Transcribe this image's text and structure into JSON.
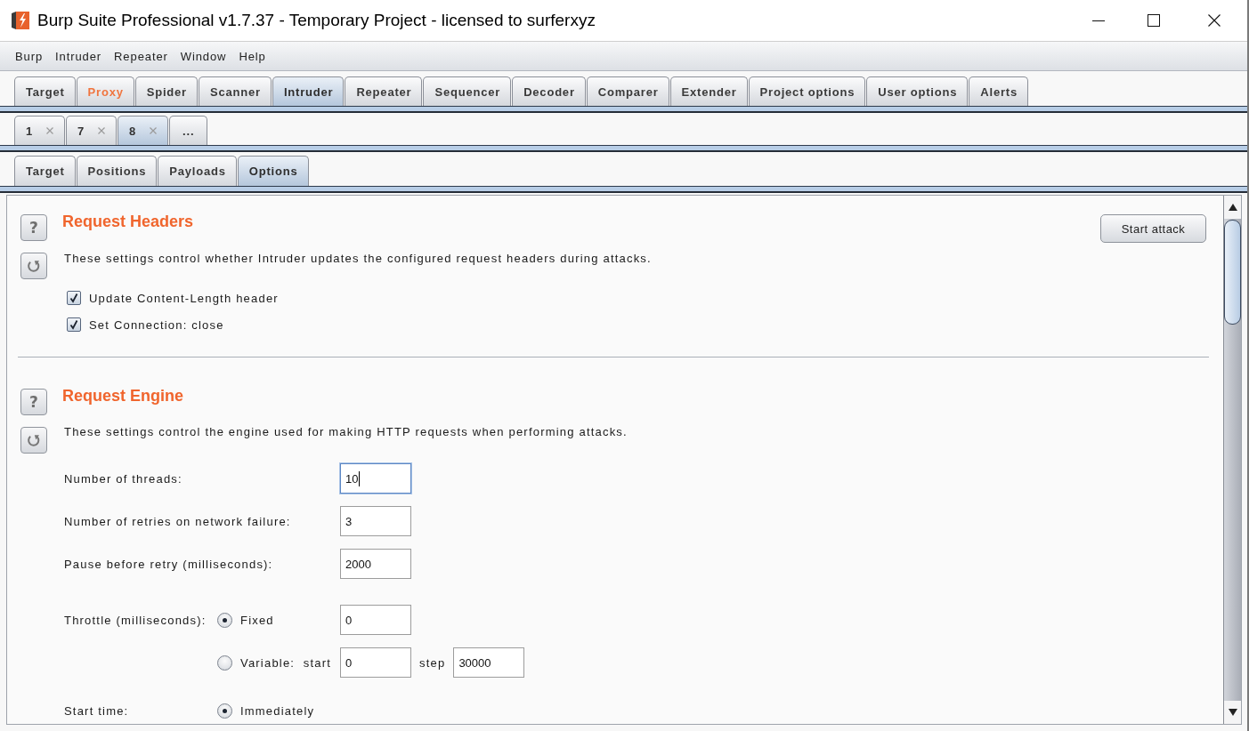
{
  "window": {
    "title": "Burp Suite Professional v1.7.37 - Temporary Project - licensed to surferxyz"
  },
  "menu": [
    {
      "label": "Burp"
    },
    {
      "label": "Intruder"
    },
    {
      "label": "Repeater"
    },
    {
      "label": "Window"
    },
    {
      "label": "Help"
    }
  ],
  "main_tabs": [
    {
      "label": "Target",
      "selected": false,
      "highlighted": false
    },
    {
      "label": "Proxy",
      "selected": false,
      "highlighted": true
    },
    {
      "label": "Spider",
      "selected": false,
      "highlighted": false
    },
    {
      "label": "Scanner",
      "selected": false,
      "highlighted": false
    },
    {
      "label": "Intruder",
      "selected": true,
      "highlighted": false
    },
    {
      "label": "Repeater",
      "selected": false,
      "highlighted": false
    },
    {
      "label": "Sequencer",
      "selected": false,
      "highlighted": false
    },
    {
      "label": "Decoder",
      "selected": false,
      "highlighted": false
    },
    {
      "label": "Comparer",
      "selected": false,
      "highlighted": false
    },
    {
      "label": "Extender",
      "selected": false,
      "highlighted": false
    },
    {
      "label": "Project options",
      "selected": false,
      "highlighted": false
    },
    {
      "label": "User options",
      "selected": false,
      "highlighted": false
    },
    {
      "label": "Alerts",
      "selected": false,
      "highlighted": false
    }
  ],
  "attack_tabs": [
    {
      "label": "1",
      "selected": false,
      "closable": true
    },
    {
      "label": "7",
      "selected": false,
      "closable": true
    },
    {
      "label": "8",
      "selected": true,
      "closable": true
    },
    {
      "label": "...",
      "selected": false,
      "closable": false
    }
  ],
  "sub_tabs": [
    {
      "label": "Target",
      "selected": false
    },
    {
      "label": "Positions",
      "selected": false
    },
    {
      "label": "Payloads",
      "selected": false
    },
    {
      "label": "Options",
      "selected": true
    }
  ],
  "sections": [
    {
      "title": "Request Headers",
      "help": "?",
      "button": "Start attack",
      "description": "These settings control whether Intruder updates the configured request headers during attacks.",
      "settings": [
        {
          "kind": "checkbox",
          "label": "Update Content-Length header",
          "checked": true
        },
        {
          "kind": "checkbox",
          "label": "Set Connection: close",
          "checked": true
        }
      ]
    },
    {
      "title": "Request Engine",
      "help": "?",
      "description": "These settings control the engine used for making HTTP requests when performing attacks.",
      "settings": [
        {
          "kind": "field",
          "label": "Number of threads:",
          "value": "10",
          "focused": true
        },
        {
          "kind": "field",
          "label": "Number of retries on network failure:",
          "value": "3",
          "focused": false
        },
        {
          "kind": "field",
          "label": "Pause before retry (milliseconds):",
          "value": "2000",
          "focused": false
        },
        {
          "kind": "choice",
          "label": "Throttle (milliseconds):",
          "options": [
            {
              "label": "Fixed",
              "selected": true,
              "value": "0"
            },
            {
              "label": "Variable:",
              "selected": false,
              "start_label": "start",
              "value": "0",
              "step_label": "step",
              "step_value": "30000"
            }
          ]
        },
        {
          "kind": "choice",
          "label": "Start time:",
          "options": [
            {
              "label": "Immediately",
              "selected": true
            }
          ]
        }
      ]
    }
  ]
}
